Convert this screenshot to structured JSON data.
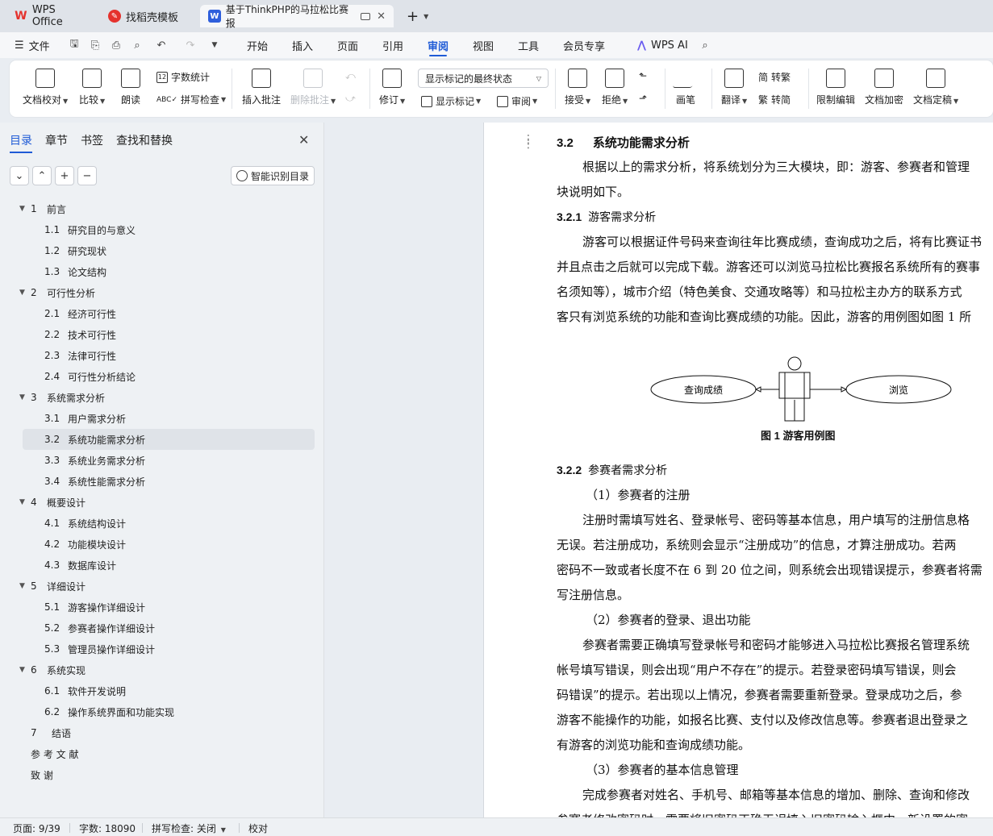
{
  "tabs": [
    {
      "label": "WPS Office",
      "icon": "wps-logo-icon",
      "color": "#e5322d"
    },
    {
      "label": "找稻壳模板",
      "icon": "docer-logo-icon",
      "color": "#e5322d"
    },
    {
      "label": "基于ThinkPHP的马拉松比赛报",
      "icon": "word-doc-icon",
      "color": "#2f5fdc"
    }
  ],
  "menubar": {
    "file": "文件",
    "items": [
      "开始",
      "插入",
      "页面",
      "引用",
      "审阅",
      "视图",
      "工具",
      "会员专享"
    ],
    "active": "审阅",
    "ai": "WPS AI"
  },
  "ribbon": {
    "doc_check": "文档校对",
    "compare": "比较",
    "read_aloud": "朗读",
    "word_count": "字数统计",
    "spell_check": "拼写检查",
    "insert_comment": "插入批注",
    "delete_comment": "删除批注",
    "track_changes": "修订",
    "display_select": "显示标记的最终状态",
    "show_markup": "显示标记",
    "review": "审阅",
    "accept": "接受",
    "reject": "拒绝",
    "pen": "画笔",
    "translate": "翻译",
    "to_traditional": "转繁",
    "to_simplified": "转简",
    "restrict_edit": "限制编辑",
    "encrypt": "文档加密",
    "finalize": "文档定稿"
  },
  "nav": {
    "tabs": [
      "目录",
      "章节",
      "书签",
      "查找和替换"
    ],
    "smart_button": "智能识别目录",
    "toc": [
      {
        "num": "1",
        "text": "前言",
        "level": 1,
        "expanded": true
      },
      {
        "num": "1.1",
        "text": "研究目的与意义",
        "level": 2
      },
      {
        "num": "1.2",
        "text": "研究现状",
        "level": 2
      },
      {
        "num": "1.3",
        "text": "论文结构",
        "level": 2
      },
      {
        "num": "2",
        "text": "可行性分析",
        "level": 1,
        "expanded": true
      },
      {
        "num": "2.1",
        "text": "经济可行性",
        "level": 2
      },
      {
        "num": "2.2",
        "text": "技术可行性",
        "level": 2
      },
      {
        "num": "2.3",
        "text": "法律可行性",
        "level": 2
      },
      {
        "num": "2.4",
        "text": "可行性分析结论",
        "level": 2
      },
      {
        "num": "3",
        "text": "系统需求分析",
        "level": 1,
        "expanded": true
      },
      {
        "num": "3.1",
        "text": "用户需求分析",
        "level": 2
      },
      {
        "num": "3.2",
        "text": "系统功能需求分析",
        "level": 2,
        "selected": true
      },
      {
        "num": "3.3",
        "text": "系统业务需求分析",
        "level": 2
      },
      {
        "num": "3.4",
        "text": "系统性能需求分析",
        "level": 2
      },
      {
        "num": "4",
        "text": "概要设计",
        "level": 1,
        "expanded": true
      },
      {
        "num": "4.1",
        "text": "系统结构设计",
        "level": 2
      },
      {
        "num": "4.2",
        "text": "功能模块设计",
        "level": 2
      },
      {
        "num": "4.3",
        "text": "数据库设计",
        "level": 2
      },
      {
        "num": "5",
        "text": "详细设计",
        "level": 1,
        "expanded": true
      },
      {
        "num": "5.1",
        "text": "游客操作详细设计",
        "level": 2
      },
      {
        "num": "5.2",
        "text": "参赛者操作详细设计",
        "level": 2
      },
      {
        "num": "5.3",
        "text": "管理员操作详细设计",
        "level": 2
      },
      {
        "num": "6",
        "text": "系统实现",
        "level": 1,
        "expanded": true
      },
      {
        "num": "6.1",
        "text": "软件开发说明",
        "level": 2
      },
      {
        "num": "6.2",
        "text": "操作系统界面和功能实现",
        "level": 2
      },
      {
        "num": "7",
        "text": "结语",
        "level": 0
      },
      {
        "num": "",
        "text": "参 考 文 献",
        "level": 0
      },
      {
        "num": "",
        "text": "致          谢",
        "level": 0
      }
    ]
  },
  "document": {
    "heading_32_num": "3.2",
    "heading_32": "系统功能需求分析",
    "p1a": "根据以上的需求分析，将系统划分为三大模块，即：游客、参赛者和管理",
    "p1b": "块说明如下。",
    "h321_num": "3.2.1",
    "h321": "游客需求分析",
    "p2a": "游客可以根据证件号码来查询往年比赛成绩，查询成功之后，将有比赛证书",
    "p2b": "并且点击之后就可以完成下载。游客还可以浏览马拉松比赛报名系统所有的赛事",
    "p2c": "名须知等），城市介绍（特色美食、交通攻略等）和马拉松主办方的联系方式",
    "p2d": "客只有浏览系统的功能和查询比赛成绩的功能。因此，游客的用例图如图 1 所",
    "diagram": {
      "left_case": "查询成绩",
      "right_case": "浏览"
    },
    "fig1": "图 1  游客用例图",
    "h322_num": "3.2.2",
    "h322": "参赛者需求分析",
    "s1": "（1）参赛者的注册",
    "p3a": "注册时需填写姓名、登录帐号、密码等基本信息，用户填写的注册信息格",
    "p3b": "无误。若注册成功，系统则会显示“注册成功”的信息，才算注册成功。若两",
    "p3c": "密码不一致或者长度不在 6 到 20 位之间，则系统会出现错误提示，参赛者将需",
    "p3d": "写注册信息。",
    "s2": "（2）参赛者的登录、退出功能",
    "p4a": "参赛者需要正确填写登录帐号和密码才能够进入马拉松比赛报名管理系统",
    "p4b": "帐号填写错误，则会出现“用户不存在”的提示。若登录密码填写错误，则会",
    "p4c": "码错误”的提示。若出现以上情况，参赛者需要重新登录。登录成功之后，参",
    "p4d": "游客不能操作的功能，如报名比赛、支付以及修改信息等。参赛者退出登录之",
    "p4e": "有游客的浏览功能和查询成绩功能。",
    "s3": "（3）参赛者的基本信息管理",
    "p5a": "完成参赛者对姓名、手机号、邮箱等基本信息的增加、删除、查询和修改",
    "p5b": "参赛者修改密码时，需要将旧密码正确无误填入旧密码输入框中，新设置的密"
  },
  "status": {
    "page": "页面: 9/39",
    "words": "字数: 18090",
    "spell": "拼写检查: 关闭",
    "proof": "校对"
  }
}
